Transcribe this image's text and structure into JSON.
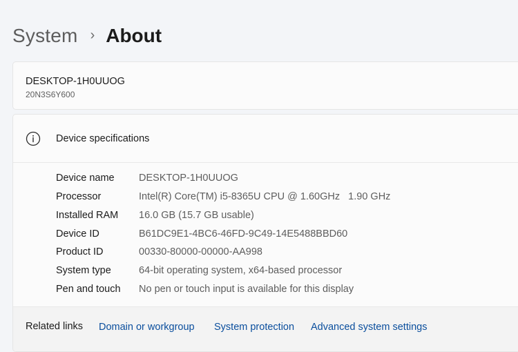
{
  "breadcrumb": {
    "parent": "System",
    "separator": "›",
    "current": "About"
  },
  "device": {
    "name": "DESKTOP-1H0UUOG",
    "model": "20N3S6Y600"
  },
  "specs": {
    "title": "Device specifications",
    "icon": "info-icon",
    "rows": [
      {
        "label": "Device name",
        "value": "DESKTOP-1H0UUOG"
      },
      {
        "label": "Processor",
        "value": "Intel(R) Core(TM) i5-8365U CPU @ 1.60GHz   1.90 GHz"
      },
      {
        "label": "Installed RAM",
        "value": "16.0 GB (15.7 GB usable)"
      },
      {
        "label": "Device ID",
        "value": "B61DC9E1-4BC6-46FD-9C49-14E5488BBD60"
      },
      {
        "label": "Product ID",
        "value": "00330-80000-00000-AA998"
      },
      {
        "label": "System type",
        "value": "64-bit operating system, x64-based processor"
      },
      {
        "label": "Pen and touch",
        "value": "No pen or touch input is available for this display"
      }
    ]
  },
  "related": {
    "label": "Related links",
    "links": [
      "Domain or workgroup",
      "System protection",
      "Advanced system settings"
    ]
  },
  "colors": {
    "link": "#0a4e9d",
    "background": "#f3f5f8",
    "card": "#fbfbfb"
  }
}
